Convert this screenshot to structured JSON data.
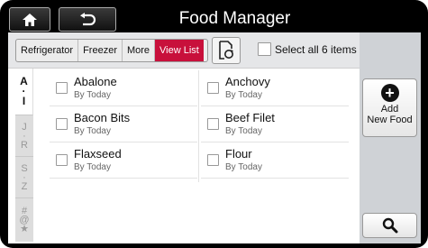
{
  "header": {
    "title": "Food Manager",
    "home_icon": "home-icon",
    "back_icon": "back-arrow-icon"
  },
  "tabs": [
    {
      "label": "Refrigerator",
      "active": false
    },
    {
      "label": "Freezer",
      "active": false
    },
    {
      "label": "More",
      "active": false
    },
    {
      "label": "View List",
      "active": true
    }
  ],
  "sync_icon": "sync-icon",
  "select_all": {
    "label": "Select all 6 items",
    "checked": false
  },
  "alpha_index": [
    {
      "lines": [
        "A",
        "·",
        "I"
      ],
      "active": true
    },
    {
      "lines": [
        "J",
        "·",
        "R"
      ],
      "active": false
    },
    {
      "lines": [
        "S",
        "·",
        "Z"
      ],
      "active": false
    },
    {
      "lines": [
        "#",
        "@",
        "★"
      ],
      "active": false
    }
  ],
  "items": [
    {
      "name": "Abalone",
      "sub": "By Today"
    },
    {
      "name": "Anchovy",
      "sub": "By Today"
    },
    {
      "name": "Bacon Bits",
      "sub": "By Today"
    },
    {
      "name": "Beef Filet",
      "sub": "By Today"
    },
    {
      "name": "Flaxseed",
      "sub": "By Today"
    },
    {
      "name": "Flour",
      "sub": "By Today"
    }
  ],
  "add_button": {
    "line1": "Add",
    "line2": "New Food",
    "icon": "plus-circle-icon"
  },
  "search_icon": "search-icon",
  "colors": {
    "accent": "#c8103b",
    "frame": "#000000",
    "sidebar": "#cfd2d6"
  }
}
